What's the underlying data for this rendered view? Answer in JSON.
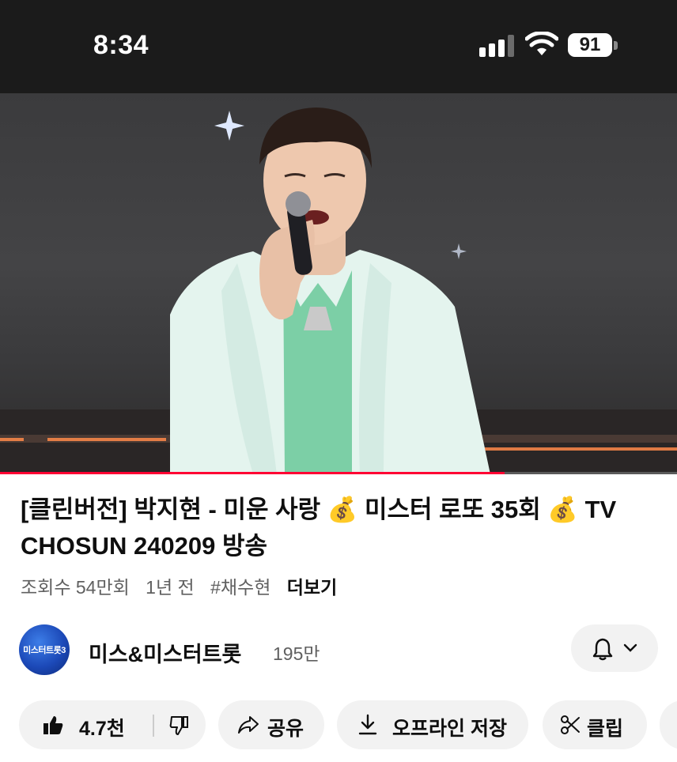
{
  "status_bar": {
    "time": "8:34",
    "battery": "91",
    "icons": [
      "signal-icon",
      "wifi-icon",
      "battery-icon"
    ]
  },
  "player": {
    "progress": 0.745,
    "accent": "#ff0033"
  },
  "video": {
    "title": "[클린버전] 박지현 - 미운 사랑 💰 미스터 로또 35회 💰 TV CHOSUN 240209 방송",
    "views": "조회수 54만회",
    "age": "1년 전",
    "hashtag": "#채수현",
    "more": "더보기"
  },
  "channel": {
    "name": "미스&미스터트롯",
    "subscribers": "195만",
    "avatar_text": "미스터트롯3"
  },
  "actions": {
    "likes": "4.7천",
    "share": "공유",
    "download": "오프라인 저장",
    "clip": "클립"
  }
}
